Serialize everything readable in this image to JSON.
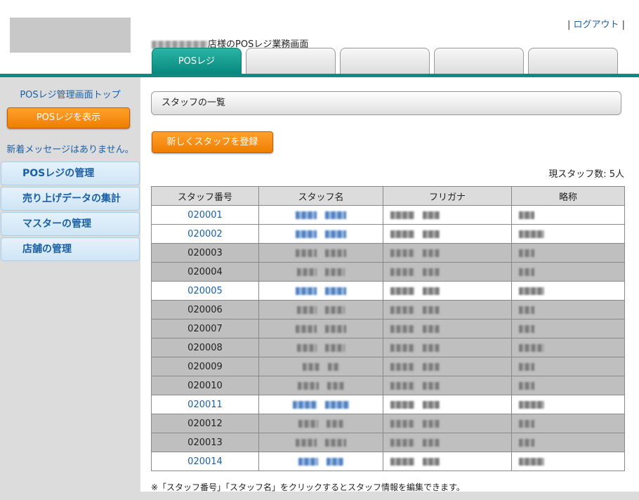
{
  "header": {
    "logout_prefix": "| ",
    "logout_label": "ログアウト",
    "logout_suffix": " |",
    "shop_title_suffix": "店様のPOSレジ業務画面",
    "tabs": [
      {
        "label": "POSレジ",
        "active": true
      },
      {
        "label": "",
        "active": false
      },
      {
        "label": "",
        "active": false
      },
      {
        "label": "",
        "active": false
      },
      {
        "label": "",
        "active": false
      }
    ]
  },
  "sidebar": {
    "top_link": "POSレジ管理画面トップ",
    "show_pos_button": "POSレジを表示",
    "no_messages": "新着メッセージはありません。",
    "menu": [
      {
        "label": "POSレジの管理"
      },
      {
        "label": "売り上げデータの集計"
      },
      {
        "label": "マスターの管理"
      },
      {
        "label": "店舗の管理"
      }
    ]
  },
  "main": {
    "section_title": "スタッフの一覧",
    "register_button": "新しくスタッフを登録",
    "staff_count_label": "現スタッフ数: 5人",
    "table": {
      "headers": [
        "スタッフ番号",
        "スタッフ名",
        "フリガナ",
        "略称"
      ],
      "rows": [
        {
          "id": "020001",
          "active": true
        },
        {
          "id": "020002",
          "active": true
        },
        {
          "id": "020003",
          "active": false
        },
        {
          "id": "020004",
          "active": false
        },
        {
          "id": "020005",
          "active": true
        },
        {
          "id": "020006",
          "active": false
        },
        {
          "id": "020007",
          "active": false
        },
        {
          "id": "020008",
          "active": false
        },
        {
          "id": "020009",
          "active": false
        },
        {
          "id": "020010",
          "active": false
        },
        {
          "id": "020011",
          "active": true
        },
        {
          "id": "020012",
          "active": false
        },
        {
          "id": "020013",
          "active": false
        },
        {
          "id": "020014",
          "active": true
        }
      ]
    },
    "footnote": "※「スタッフ番号」「スタッフ名」をクリックするとスタッフ情報を編集できます。"
  },
  "colors": {
    "teal": "#0f8a80",
    "orange": "#f07d00",
    "link_blue": "#1a5fa6",
    "inactive_row": "#bfbfbf"
  }
}
